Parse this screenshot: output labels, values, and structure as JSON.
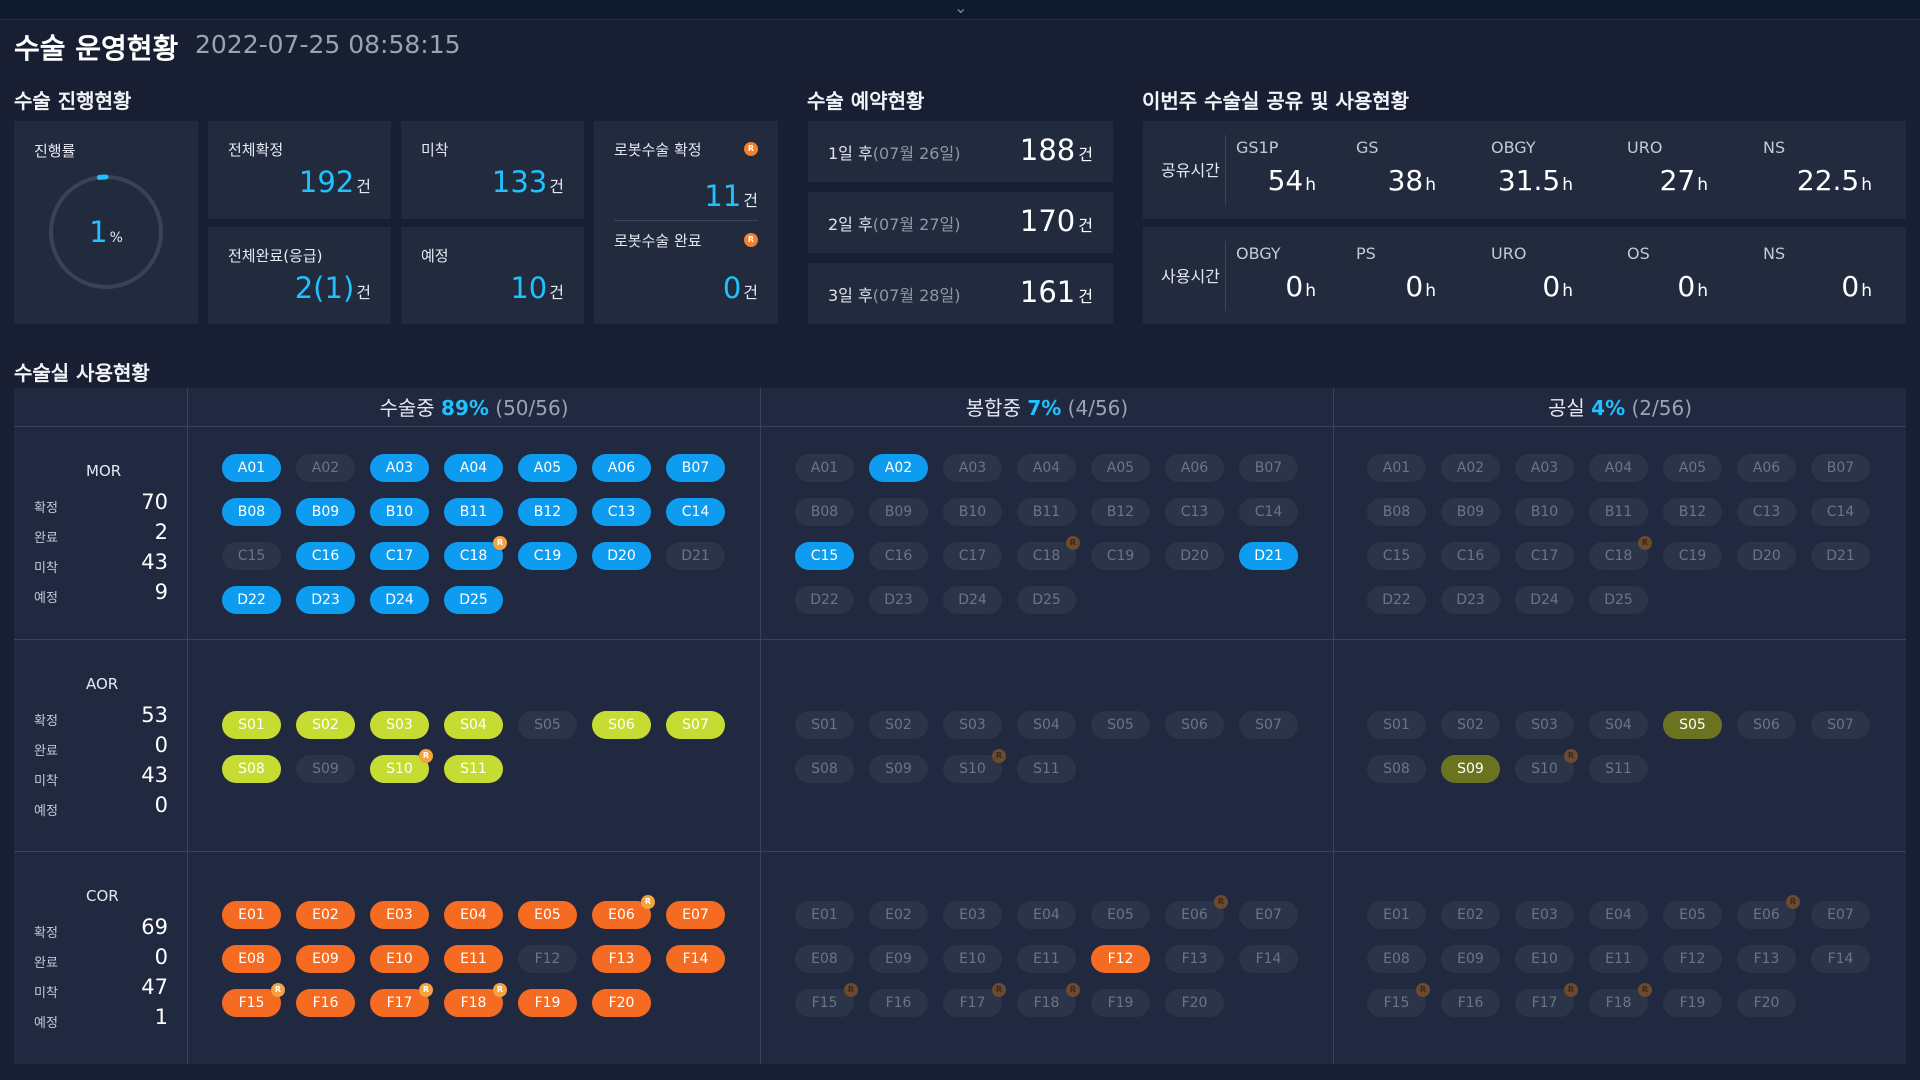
{
  "header": {
    "title": "수술 운영현황",
    "datetime": "2022-07-25 08:58:15",
    "collapse_icon": "chevron-down-icon"
  },
  "progress": {
    "section_title": "수술 진행현황",
    "rate_label": "진행률",
    "rate_value": "1",
    "rate_unit": "%",
    "rate_fraction": 0.01,
    "total_confirmed_label": "전체확정",
    "total_confirmed": "192",
    "arrival_pending_label": "미착",
    "arrival_pending": "133",
    "robot_confirmed_label": "로봇수술 확정",
    "robot_confirmed": "11",
    "total_done_label": "전체완료(응급)",
    "total_done": "2(1)",
    "scheduled_label": "예정",
    "scheduled": "10",
    "robot_done_label": "로봇수술 완료",
    "robot_done": "0",
    "unit": "건",
    "robot_badge": "R"
  },
  "reservation": {
    "section_title": "수술 예약현황",
    "rows": [
      {
        "label": "1일 후",
        "date": "(07월 26일)",
        "value": "188",
        "unit": "건"
      },
      {
        "label": "2일 후",
        "date": "(07월 27일)",
        "value": "170",
        "unit": "건"
      },
      {
        "label": "3일 후",
        "date": "(07월 28일)",
        "value": "161",
        "unit": "건"
      }
    ]
  },
  "sharing": {
    "section_title": "이번주 수술실 공유 및 사용현황",
    "share_label": "공유시간",
    "share_items": [
      {
        "name": "GS1P",
        "value": "54",
        "unit": "h"
      },
      {
        "name": "GS",
        "value": "38",
        "unit": "h"
      },
      {
        "name": "OBGY",
        "value": "31.5",
        "unit": "h"
      },
      {
        "name": "URO",
        "value": "27",
        "unit": "h"
      },
      {
        "name": "NS",
        "value": "22.5",
        "unit": "h"
      }
    ],
    "use_label": "사용시간",
    "use_items": [
      {
        "name": "OBGY",
        "value": "0",
        "unit": "h"
      },
      {
        "name": "PS",
        "value": "0",
        "unit": "h"
      },
      {
        "name": "URO",
        "value": "0",
        "unit": "h"
      },
      {
        "name": "OS",
        "value": "0",
        "unit": "h"
      },
      {
        "name": "NS",
        "value": "0",
        "unit": "h"
      }
    ]
  },
  "rooms": {
    "section_title": "수술실 사용현황",
    "columns": [
      {
        "label": "수술중",
        "pct": "89%",
        "count": "(50/56)"
      },
      {
        "label": "봉합중",
        "pct": "7%",
        "count": "(4/56)"
      },
      {
        "label": "공실",
        "pct": "4%",
        "count": "(2/56)"
      }
    ],
    "stat_labels": [
      "확정",
      "완료",
      "미착",
      "예정"
    ],
    "zones": [
      {
        "name": "MOR",
        "stats": [
          "70",
          "2",
          "43",
          "9"
        ],
        "rooms": [
          "A01",
          "A02",
          "A03",
          "A04",
          "A05",
          "A06",
          "B07",
          "B08",
          "B09",
          "B10",
          "B11",
          "B12",
          "C13",
          "C14",
          "C15",
          "C16",
          "C17",
          "C18",
          "C19",
          "D20",
          "D21",
          "D22",
          "D23",
          "D24",
          "D25"
        ],
        "robot": [
          "C18"
        ],
        "active": [
          [
            "A01",
            "A03",
            "A04",
            "A05",
            "A06",
            "B07",
            "B08",
            "B09",
            "B10",
            "B11",
            "B12",
            "C13",
            "C14",
            "C16",
            "C17",
            "C18",
            "C19",
            "D20",
            "D22",
            "D23",
            "D24",
            "D25"
          ],
          [
            "A02",
            "C15",
            "D21"
          ],
          []
        ],
        "color": "blue"
      },
      {
        "name": "AOR",
        "stats": [
          "53",
          "0",
          "43",
          "0"
        ],
        "rooms": [
          "S01",
          "S02",
          "S03",
          "S04",
          "S05",
          "S06",
          "S07",
          "S08",
          "S09",
          "S10",
          "S11"
        ],
        "robot": [
          "S10"
        ],
        "active": [
          [
            "S01",
            "S02",
            "S03",
            "S04",
            "S06",
            "S07",
            "S08",
            "S10",
            "S11"
          ],
          [],
          [
            "S05",
            "S09"
          ]
        ],
        "color": "lime"
      },
      {
        "name": "COR",
        "stats": [
          "69",
          "0",
          "47",
          "1"
        ],
        "rooms": [
          "E01",
          "E02",
          "E03",
          "E04",
          "E05",
          "E06",
          "E07",
          "E08",
          "E09",
          "E10",
          "E11",
          "F12",
          "F13",
          "F14",
          "F15",
          "F16",
          "F17",
          "F18",
          "F19",
          "F20"
        ],
        "robot": [
          "E06",
          "F15",
          "F17",
          "F18"
        ],
        "active": [
          [
            "E01",
            "E02",
            "E03",
            "E04",
            "E05",
            "E06",
            "E07",
            "E08",
            "E09",
            "E10",
            "E11",
            "F13",
            "F14",
            "F15",
            "F16",
            "F17",
            "F18",
            "F19",
            "F20"
          ],
          [
            "F12"
          ],
          []
        ],
        "color": "orange"
      }
    ]
  },
  "colors": {
    "accent": "#1fc2ff",
    "blue": "#0d9cf0",
    "lime": "#c7dc32",
    "olive": "#6b7320",
    "orange": "#f56b22",
    "robot": "#f47f2a"
  }
}
